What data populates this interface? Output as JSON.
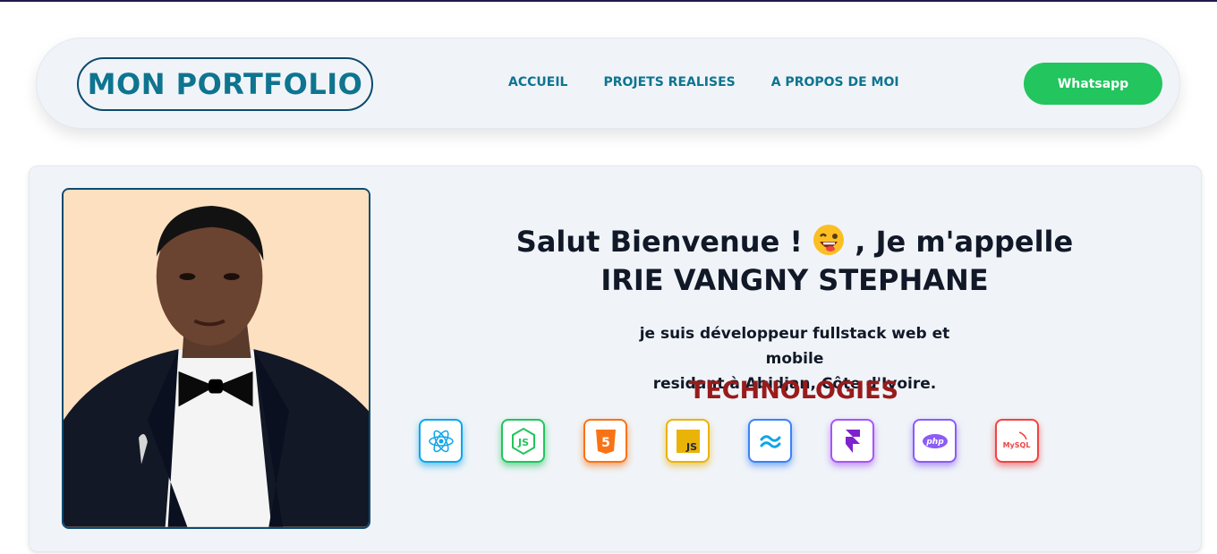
{
  "navbar": {
    "logo": "MON PORTFOLIO",
    "links": [
      "ACCUEIL",
      "PROJETS REALISES",
      "A PROPOS DE MOI"
    ],
    "cta_label": "Whatsapp"
  },
  "hero": {
    "title_part1": "Salut Bienvenue !",
    "title_part2": ", Je m'appelle IRIE VANGNY STEPHANE",
    "desc_line1": "je suis développeur fullstack web et mobile",
    "desc_line2": "residant à Abidjan, Côte d'Ivoire.",
    "tech_title": "TECHNOLOGIES",
    "technologies": [
      {
        "icon": "react-icon",
        "color": "#0ea5e9",
        "label": "React"
      },
      {
        "icon": "nodejs-icon",
        "color": "#22c55e",
        "label": "JS"
      },
      {
        "icon": "html5-icon",
        "color": "#f97316",
        "label": "5"
      },
      {
        "icon": "javascript-icon",
        "color": "#eab308",
        "label": "JS"
      },
      {
        "icon": "tailwind-icon",
        "color": "#3b82f6",
        "label": "Tailwind"
      },
      {
        "icon": "framer-icon",
        "color": "#a855f7",
        "label": "Framer"
      },
      {
        "icon": "php-icon",
        "color": "#8b5cf6",
        "label": "php"
      },
      {
        "icon": "mysql-icon",
        "color": "#ef4444",
        "label": "MySQL"
      }
    ]
  },
  "colors": {
    "accent": "#0e7490",
    "whatsapp": "#22c55e",
    "tech_title": "#991b1b"
  }
}
